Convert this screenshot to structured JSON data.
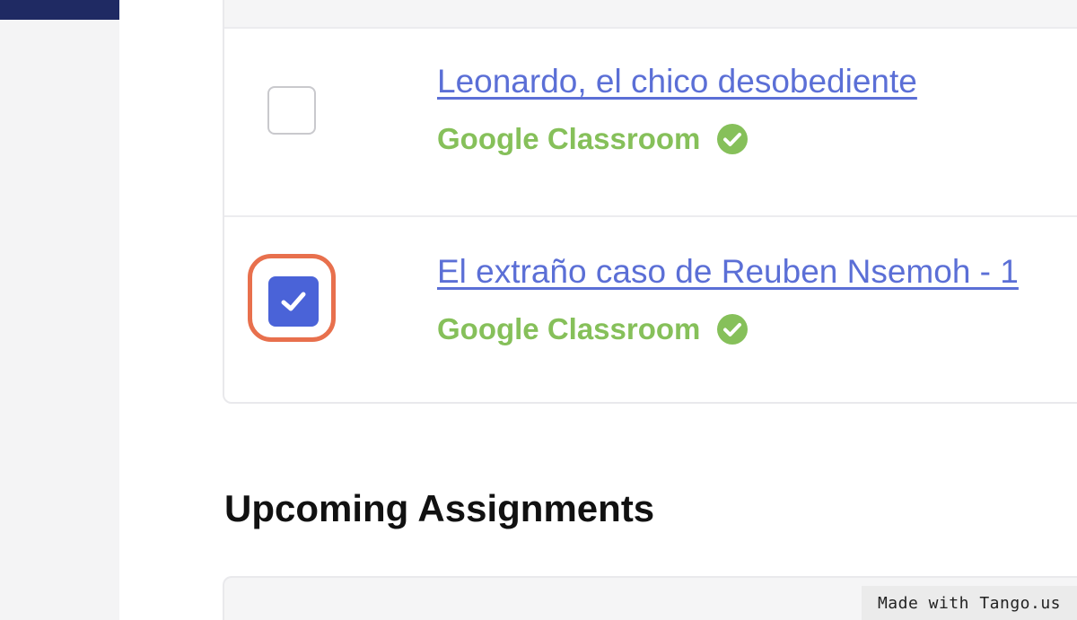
{
  "assignments": [
    {
      "title": "Leonardo, el chico desobediente",
      "sync_label": "Google Classroom",
      "sync_icon": "check-circle-icon",
      "checked": false
    },
    {
      "title": "El extraño caso de Reuben Nsemoh - 1",
      "sync_label": "Google Classroom",
      "sync_icon": "check-circle-icon",
      "checked": true
    }
  ],
  "upcoming": {
    "title": "Upcoming Assignments"
  },
  "watermark": {
    "text": "Made with Tango.us"
  },
  "colors": {
    "link": "#5b6fd6",
    "sync_green": "#86c05a",
    "checkbox_checked": "#4a63d8",
    "highlight_ring": "#e8704d",
    "sidebar_top": "#1f2a63"
  }
}
